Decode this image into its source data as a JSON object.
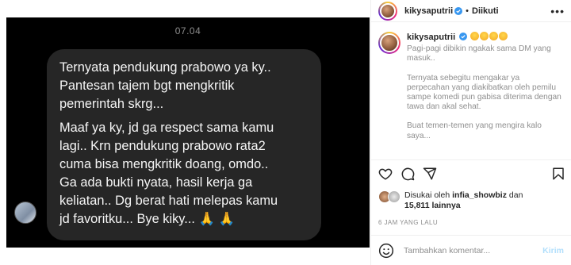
{
  "dm": {
    "timestamp": "07.04",
    "message_paragraphs": [
      "Ternyata pendukung prabowo ya ky..\nPantesan tajem bgt mengkritik\npemerintah skrg...",
      "Maaf ya ky, jd ga respect sama kamu\nlagi.. Krn pendukung prabowo rata2\ncuma bisa mengkritik doang, omdo..\nGa ada bukti nyata, hasil kerja ga\nkeliatan.. Dg berat hati melepas kamu\njd favoritku... Bye kiky... 🙏 🙏"
    ]
  },
  "post": {
    "username": "kikysaputrii",
    "follow_label": "Diikuti",
    "more_label": "•••",
    "caption_paragraphs": [
      "Pagi-pagi dibikin ngakak sama DM yang masuk..",
      "Ternyata sebegitu mengakar ya perpecahan yang diakibatkan oleh pemilu sampe komedi pun gabisa diterima dengan tawa dan akal sehat.",
      "Buat temen-temen yang mengira kalo saya..."
    ],
    "liked_prefix": "Disukai oleh",
    "liked_by": "infia_showbiz",
    "liked_and": "dan",
    "likes_count": "15,811",
    "likes_suffix": "lainnya",
    "time_ago": "6 JAM YANG LALU",
    "comment_placeholder": "Tambahkan komentar...",
    "send_label": "Kirim"
  },
  "colors": {
    "verified_blue": "#3897f0",
    "send_disabled": "#b2dffc",
    "bubble_bg": "#262626"
  },
  "icons": [
    "verified-badge-icon",
    "heart-icon",
    "comment-icon",
    "share-icon",
    "bookmark-icon",
    "emoji-icon",
    "more-icon"
  ]
}
